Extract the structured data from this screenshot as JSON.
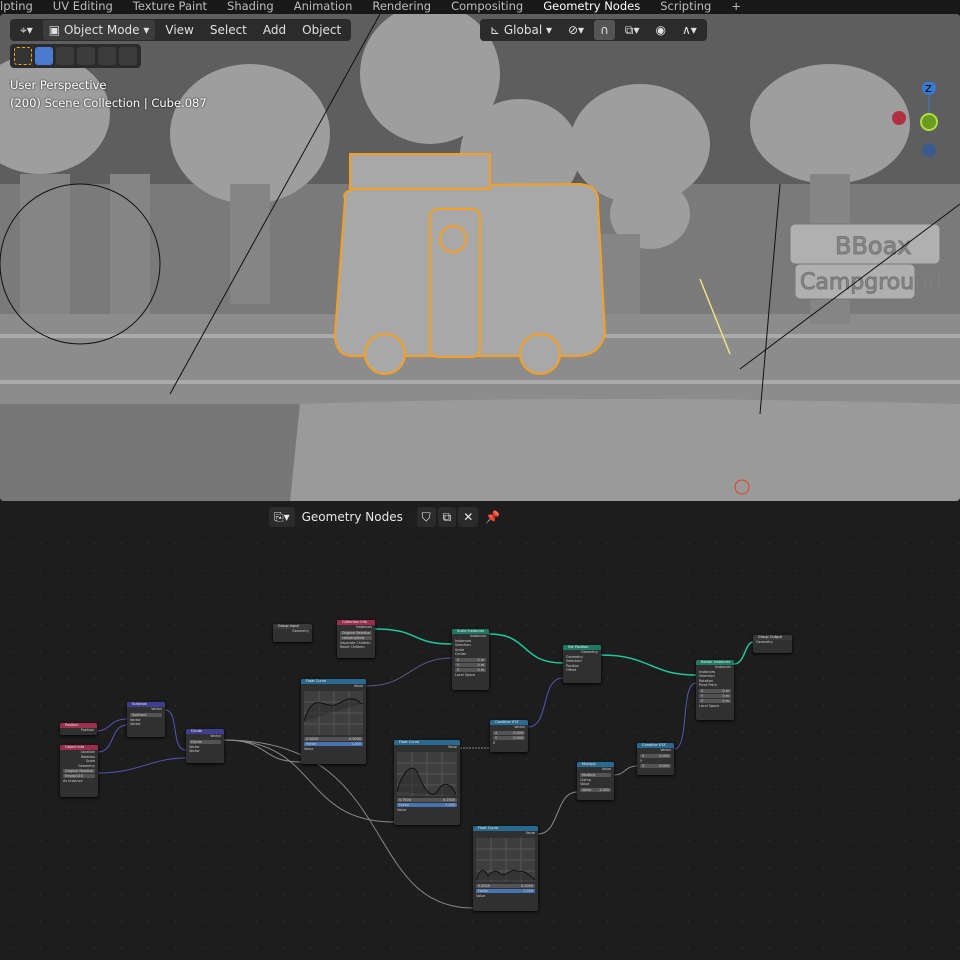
{
  "workspace_tabs": [
    "lpting",
    "UV Editing",
    "Texture Paint",
    "Shading",
    "Animation",
    "Rendering",
    "Compositing",
    "Geometry Nodes",
    "Scripting",
    "+"
  ],
  "viewport": {
    "mode": "Object Mode",
    "menus": [
      "View",
      "Select",
      "Add",
      "Object"
    ],
    "transform_orientation": "Global",
    "perspective_label": "User Perspective",
    "collection_label": "(200) Scene Collection | Cube.087",
    "sign_text": [
      "BBoax",
      "Campground"
    ],
    "gizmo_axes": [
      "Z"
    ],
    "colors": {
      "selection": "#f5a020",
      "background": "#6a6a6a"
    }
  },
  "node_editor": {
    "tree_name": "Geometry Nodes",
    "nodes": {
      "group_input": {
        "title": "Group Input",
        "rows": [
          "Geometry"
        ]
      },
      "collection_info": {
        "title": "Collection Info",
        "out": "Instances",
        "toggle": [
          "Original",
          "Relative"
        ],
        "collection": "campingGear",
        "rows": [
          "Separate Children",
          "Reset Children"
        ]
      },
      "scale_instances": {
        "title": "Scale Instances",
        "out": "Instances",
        "rows": [
          "Instances",
          "Selection",
          "Scale",
          "Center"
        ],
        "fields": [
          [
            "X",
            "0 m"
          ],
          [
            "Y",
            "0 m"
          ],
          [
            "Z",
            "0 m"
          ]
        ],
        "check": "Local Space"
      },
      "set_position": {
        "title": "Set Position",
        "out": "Geometry",
        "rows": [
          "Geometry",
          "Selection",
          "Position",
          "Offset"
        ]
      },
      "rotate_instances": {
        "title": "Rotate Instances",
        "out": "Instances",
        "rows": [
          "Instances",
          "Selection",
          "Rotation",
          "Pivot Point"
        ],
        "fields": [
          [
            "X",
            "0 m"
          ],
          [
            "Y",
            "0 m"
          ],
          [
            "Z",
            "0 m"
          ]
        ],
        "check": "Local Space"
      },
      "group_output": {
        "title": "Group Output",
        "rows": [
          "Geometry"
        ]
      },
      "position": {
        "title": "Position",
        "out": "Position"
      },
      "object_info": {
        "title": "Object Info",
        "rows": [
          "Location",
          "Rotation",
          "Scale",
          "Geometry"
        ],
        "toggle": [
          "Original",
          "Relative"
        ],
        "object": "Empty.010",
        "check": "As Instance"
      },
      "subtract": {
        "title": "Subtract",
        "out": "Vector",
        "op": "Subtract",
        "rows": [
          "Vector",
          "Vector"
        ]
      },
      "divide": {
        "title": "Divide",
        "out": "Vector",
        "op": "Divide",
        "rows": [
          "Vector",
          "Vector"
        ]
      },
      "float_curve_1": {
        "title": "Float Curve",
        "out": "Value",
        "fields": [
          "0.5000",
          "0.5000"
        ],
        "factor": [
          "Factor",
          "1.000"
        ],
        "in": "Value"
      },
      "float_curve_2": {
        "title": "Float Curve",
        "out": "Value",
        "fields": [
          "0.7500",
          "0.2500"
        ],
        "factor": [
          "Factor",
          "1.000"
        ],
        "in": "Value"
      },
      "float_curve_3": {
        "title": "Float Curve",
        "out": "Value",
        "fields": [
          "0.5000",
          "0.5000"
        ],
        "factor": [
          "Factor",
          "1.000"
        ],
        "in": "Value"
      },
      "combine_xyz_1": {
        "title": "Combine XYZ",
        "out": "Vector",
        "fields": [
          [
            "X",
            "0.000"
          ],
          [
            "Y",
            "0.000"
          ]
        ],
        "in": "Z"
      },
      "combine_xyz_2": {
        "title": "Combine XYZ",
        "out": "Vector",
        "fields": [
          [
            "X",
            "0.000"
          ],
          [
            "Z",
            "0.000"
          ]
        ],
        "in": "Y"
      },
      "multiply": {
        "title": "Multiply",
        "out": "Value",
        "op": "Multiply",
        "check": "Clamp",
        "in": "Value",
        "field": [
          "Value",
          "-1.000"
        ]
      }
    },
    "colors": {
      "geometry_link": "#1fc79a",
      "vector_link": "#5656b8",
      "float_link": "#9a9a9a"
    }
  }
}
